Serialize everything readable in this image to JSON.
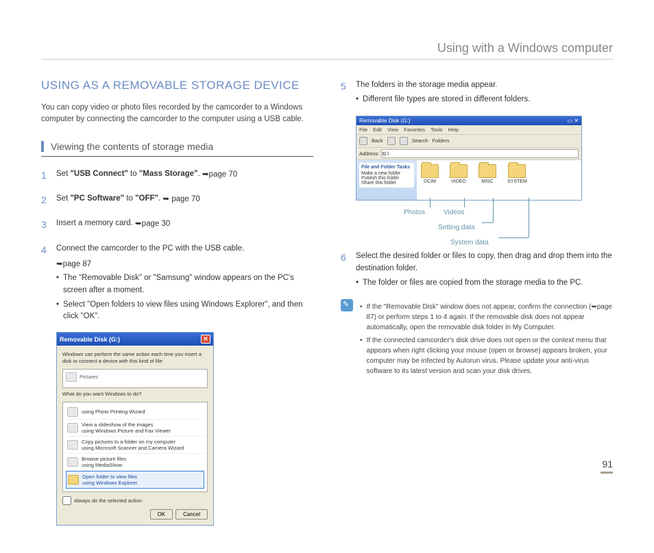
{
  "header": "Using with a Windows computer",
  "title": "USING AS A REMOVABLE STORAGE DEVICE",
  "intro": "You can copy video or photo files recorded by the camcorder to a Windows computer by connecting the camcorder to the computer using a USB cable.",
  "subhead": "Viewing the contents of storage media",
  "steps": {
    "s1": {
      "n": "1",
      "pre": "Set ",
      "b1": "\"USB Connect\"",
      "mid": " to ",
      "b2": "\"Mass Storage\"",
      "post": ". ",
      "ref": "➥page 70"
    },
    "s2": {
      "n": "2",
      "pre": "Set ",
      "b1": "\"PC Software\"",
      "mid": " to ",
      "b2": "\"OFF\"",
      "post": ". ",
      "ref": "➥ page 70"
    },
    "s3": {
      "n": "3",
      "text": "Insert a memory card. ",
      "ref": "➥page 30"
    },
    "s4": {
      "n": "4",
      "text": "Connect the camcorder to the PC with the USB cable.",
      "ref": "➥page 87",
      "b1": "The \"Removable Disk\" or \"Samsung\" window appears on the PC's screen after a moment.",
      "b2": "Select \"Open folders to view files using Windows Explorer\", and then click \"OK\"."
    },
    "s5": {
      "n": "5",
      "text": "The folders in the storage media appear.",
      "b1": "Different file types are stored in different folders."
    },
    "s6": {
      "n": "6",
      "text": "Select the desired folder or files to copy, then drag and drop them into the destination folder.",
      "b1": "The folder or files are copied from the storage media to the PC."
    }
  },
  "dialog": {
    "title": "Removable Disk (G:)",
    "line1": "Windows can perform the same action each time you insert a disk or connect a device with this kind of file:",
    "panelhdr": "Pictures",
    "q": "What do you want Windows to do?",
    "i1": "using Photo Printing Wizard",
    "i2a": "View a slideshow of the images",
    "i2b": "using Windows Picture and Fax Viewer",
    "i3a": "Copy pictures to a folder on my computer",
    "i3b": "using Microsoft Scanner and Camera Wizard",
    "i4a": "Browse picture files",
    "i4b": "using MediaShow",
    "i5a": "Open folder to view files",
    "i5b": "using Windows Explorer",
    "chk": "Always do the selected action.",
    "ok": "OK",
    "cancel": "Cancel"
  },
  "explorer": {
    "title": "Removable Disk (G:)",
    "menu": [
      "File",
      "Edit",
      "View",
      "Favorites",
      "Tools",
      "Help"
    ],
    "tool": [
      "Back",
      "",
      "Search",
      "Folders"
    ],
    "addrLabel": "Address",
    "addr": "G:\\",
    "sideTitle": "File and Folder Tasks",
    "side1": "Make a new folder",
    "side2": "Publish this folder",
    "side3": "Share this folder",
    "folders": [
      "DCIM",
      "VIDEO",
      "MISC",
      "SYSTEM"
    ]
  },
  "labels": {
    "photos": "Photos",
    "videos": "Videos",
    "setting": "Setting data",
    "system": "System data"
  },
  "notes": {
    "n1": "If the \"Removable Disk\" window does not appear, confirm the connection (➥page 87) or perform steps 1 to 4 again. If the removable disk does not appear automatically, open the removable disk folder in My Computer.",
    "n2": "If the connected camcorder's disk drive does not open or the context menu that appears when right clicking your mouse (open or browse) appears broken, your computer may be infected by Autorun virus. Please update your anti-virus software to its latest version and scan your disk drives."
  },
  "page": "91"
}
